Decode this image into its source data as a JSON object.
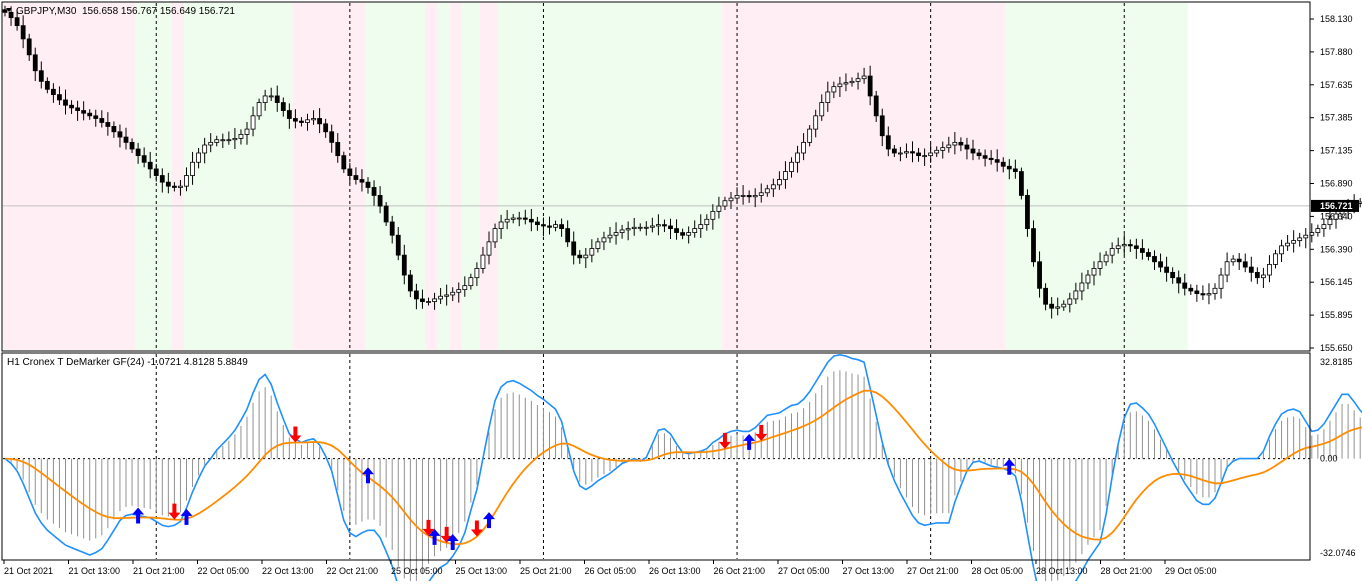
{
  "main_panel": {
    "symbol_text": "GBPJPY,M30",
    "ohlc_text": "156.658 156.767 156.649 156.721",
    "price_labels": [
      "158.130",
      "157.880",
      "157.635",
      "157.385",
      "157.135",
      "156.890",
      "156.640",
      "156.390",
      "156.145",
      "155.895",
      "155.650"
    ],
    "current_price": "156.721",
    "current_price_level": 156.721,
    "price_range": [
      155.65,
      158.13
    ],
    "candle_closes": [
      158.18,
      158.14,
      158.08,
      157.98,
      157.86,
      157.74,
      157.66,
      157.6,
      157.56,
      157.52,
      157.48,
      157.46,
      157.44,
      157.42,
      157.4,
      157.38,
      157.35,
      157.32,
      157.28,
      157.24,
      157.2,
      157.15,
      157.1,
      157.05,
      157.0,
      156.95,
      156.9,
      156.87,
      156.86,
      156.87,
      156.95,
      157.05,
      157.12,
      157.18,
      157.2,
      157.22,
      157.22,
      157.22,
      157.23,
      157.26,
      157.3,
      157.4,
      157.5,
      157.55,
      157.55,
      157.5,
      157.44,
      157.38,
      157.36,
      157.35,
      157.37,
      157.38,
      157.34,
      157.28,
      157.2,
      157.1,
      157.0,
      156.95,
      156.92,
      156.9,
      156.86,
      156.8,
      156.72,
      156.6,
      156.5,
      156.35,
      156.2,
      156.08,
      156.02,
      156.0,
      156.0,
      156.02,
      156.04,
      156.05,
      156.07,
      156.09,
      156.12,
      156.18,
      156.25,
      156.35,
      156.45,
      156.55,
      156.6,
      156.62,
      156.63,
      156.63,
      156.62,
      156.6,
      156.58,
      156.57,
      156.56,
      156.58,
      156.55,
      156.45,
      156.35,
      156.33,
      156.35,
      156.4,
      156.45,
      156.48,
      156.5,
      156.52,
      156.54,
      156.55,
      156.56,
      156.56,
      156.56,
      156.57,
      156.58,
      156.57,
      156.55,
      156.52,
      156.5,
      156.52,
      156.55,
      156.58,
      156.62,
      156.68,
      156.72,
      156.76,
      156.78,
      156.8,
      156.8,
      156.79,
      156.8,
      156.82,
      156.85,
      156.88,
      156.92,
      156.98,
      157.05,
      157.12,
      157.2,
      157.3,
      157.4,
      157.5,
      157.58,
      157.62,
      157.64,
      157.65,
      157.66,
      157.68,
      157.7,
      157.55,
      157.4,
      157.25,
      157.15,
      157.12,
      157.12,
      157.13,
      157.12,
      157.1,
      157.1,
      157.12,
      157.14,
      157.16,
      157.18,
      157.2,
      157.18,
      157.15,
      157.12,
      157.1,
      157.08,
      157.07,
      157.05,
      157.02,
      157.0,
      156.98,
      156.8,
      156.55,
      156.3,
      156.1,
      155.98,
      155.95,
      155.96,
      155.98,
      156.02,
      156.08,
      156.14,
      156.2,
      156.25,
      156.3,
      156.35,
      156.4,
      156.42,
      156.43,
      156.42,
      156.4,
      156.37,
      156.34,
      156.3,
      156.26,
      156.22,
      156.18,
      156.14,
      156.1,
      156.08,
      156.06,
      156.05,
      156.06,
      156.1,
      156.2,
      156.3,
      156.32,
      156.3,
      156.26,
      156.22,
      156.18,
      156.2,
      156.28,
      156.36,
      156.42,
      156.44,
      156.46,
      156.48,
      156.5,
      156.52,
      156.55,
      156.58,
      156.62,
      156.66,
      156.7,
      156.72,
      156.74,
      156.75,
      156.76,
      156.68,
      156.65,
      156.7,
      156.76,
      156.78,
      156.75,
      156.72
    ],
    "backgrounds": [
      {
        "start": 0,
        "end": 22,
        "color": "#ffeff4"
      },
      {
        "start": 22,
        "end": 28,
        "color": "#eefded"
      },
      {
        "start": 28,
        "end": 30,
        "color": "#ffeff4"
      },
      {
        "start": 30,
        "end": 48,
        "color": "#eefded"
      },
      {
        "start": 48,
        "end": 60,
        "color": "#ffeff4"
      },
      {
        "start": 60,
        "end": 70,
        "color": "#eefded"
      },
      {
        "start": 70,
        "end": 72,
        "color": "#ffeff4"
      },
      {
        "start": 72,
        "end": 74,
        "color": "#eefded"
      },
      {
        "start": 74,
        "end": 76,
        "color": "#ffeff4"
      },
      {
        "start": 76,
        "end": 79,
        "color": "#eefded"
      },
      {
        "start": 79,
        "end": 82,
        "color": "#ffeff4"
      },
      {
        "start": 82,
        "end": 119,
        "color": "#eefded"
      },
      {
        "start": 119,
        "end": 166,
        "color": "#ffeff4"
      },
      {
        "start": 166,
        "end": 196,
        "color": "#eefded"
      }
    ]
  },
  "indicator_panel": {
    "label": "H1 Cronex T DeMarker GF(24) -1.0721 4.8128 5.8849",
    "levels": [
      "32.8185",
      "0.00",
      "-32.0746"
    ],
    "value_range": [
      -32.0746,
      32.8185
    ],
    "zero_level": 0,
    "signals": [
      {
        "type": "buy",
        "index": 22
      },
      {
        "type": "sell",
        "index": 28
      },
      {
        "type": "buy",
        "index": 30
      },
      {
        "type": "sell",
        "index": 48
      },
      {
        "type": "buy",
        "index": 60
      },
      {
        "type": "sell",
        "index": 70
      },
      {
        "type": "buy",
        "index": 71
      },
      {
        "type": "sell",
        "index": 73
      },
      {
        "type": "buy",
        "index": 74
      },
      {
        "type": "sell",
        "index": 78
      },
      {
        "type": "buy",
        "index": 80
      },
      {
        "type": "sell",
        "index": 119
      },
      {
        "type": "buy",
        "index": 123
      },
      {
        "type": "sell",
        "index": 125
      },
      {
        "type": "buy",
        "index": 166
      }
    ]
  },
  "time_axis": {
    "labels": [
      "21 Oct 2021",
      "21 Oct 13:00",
      "21 Oct 21:00",
      "22 Oct 05:00",
      "22 Oct 13:00",
      "22 Oct 21:00",
      "25 Oct 05:00",
      "25 Oct 13:00",
      "25 Oct 21:00",
      "26 Oct 05:00",
      "26 Oct 13:00",
      "26 Oct 21:00",
      "27 Oct 05:00",
      "27 Oct 13:00",
      "27 Oct 21:00",
      "28 Oct 05:00",
      "28 Oct 13:00",
      "28 Oct 21:00",
      "29 Oct 05:00"
    ],
    "separator_indices": [
      25,
      57,
      89,
      121,
      153,
      185
    ]
  },
  "colors": {
    "candle": "#000000",
    "buy_arrow": "#0000ff",
    "sell_arrow": "#ff0000",
    "fast_line": "#1e90ff",
    "slow_line": "#ff8c00",
    "histogram": "#909090"
  }
}
